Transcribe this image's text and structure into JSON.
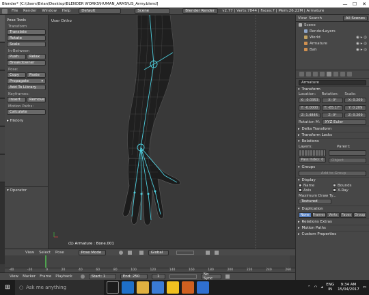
{
  "titlebar": {
    "title": "Blender* [C:\\Users\\Brian\\Desktop\\BLENDER WORKS\\HUMAN_ARMS\\US_Army.blend]",
    "controls": [
      "—",
      "☐",
      "✕"
    ]
  },
  "infobar": {
    "menus": [
      "File",
      "Render",
      "Window",
      "Help"
    ],
    "layout": "Default",
    "scene": "Scene",
    "engine": "Blender Render",
    "stats": "v2.77 | Verts:7844 | Faces:7 | Mem:26.22M | Armature"
  },
  "shelf": {
    "title": "Pose Tools",
    "transform_header": "Transform",
    "transform_buttons": [
      "Translate",
      "Rotate",
      "Scale"
    ],
    "inbetween_header": "In-Between",
    "inbetween_row": [
      "Push",
      "Relax"
    ],
    "breakdowner": "Breakdowner",
    "pose_header": "Pose:",
    "pose_row": [
      "Copy",
      "Paste"
    ],
    "propagate": "Propagate",
    "add_library": "Add To Library",
    "keyframes_header": "Keyframes:",
    "keyframes_row": [
      "Insert",
      "Remove"
    ],
    "motion_header": "Motion Paths:",
    "calculate": "Calculate",
    "history": "History",
    "operator": "Operator"
  },
  "viewport": {
    "title": "User Ortho",
    "status": "(1) Armature : Bone.001"
  },
  "vpheader": {
    "menus": [
      "View",
      "Select",
      "Pose"
    ],
    "mode": "Pose Mode",
    "orientation": "Global"
  },
  "timeline": {
    "ruler": [
      "-40",
      "-20",
      "0",
      "20",
      "40",
      "60",
      "80",
      "100",
      "120",
      "140",
      "160",
      "180",
      "200",
      "220",
      "240",
      "260"
    ],
    "menus": [
      "View",
      "Marker",
      "Frame",
      "Playback"
    ],
    "start_label": "Start:",
    "start": "1",
    "end_label": "End:",
    "end": "250",
    "current": "1",
    "sync": "No Sync"
  },
  "outliner": {
    "menus": [
      "View",
      "Search",
      "All Scenes"
    ],
    "items": [
      {
        "label": "Scene",
        "color": "#b0b0b0"
      },
      {
        "label": "RenderLayers",
        "color": "#8ea5c8"
      },
      {
        "label": "World",
        "color": "#c0a060"
      },
      {
        "label": "Armature",
        "color": "#d09050"
      },
      {
        "label": "Bah",
        "color": "#d09050"
      }
    ]
  },
  "props": {
    "object_name": "Armature",
    "transform": "Transform",
    "location_label": "Location:",
    "rotation_label": "Rotation:",
    "scale_label": "Scale:",
    "location": [
      "X: -0.0353",
      "Y: -0.0000",
      "Z: 1.4846"
    ],
    "rotation": [
      "X: 0°",
      "Y: -85.17°",
      "Z: 0°"
    ],
    "scale": [
      "X: 0.209",
      "Y: 0.209",
      "Z: 0.209"
    ],
    "rotation_mode_label": "Rotation M:",
    "rotation_mode": "XYZ Euler",
    "sections1": [
      "Delta Transform",
      "Transform Locks"
    ],
    "relations": "Relations",
    "layers_label": "Layers:",
    "parent_label": "Parent:",
    "parent_value": "Object",
    "pass_index": "Pass Index:",
    "pass_index_value": "0",
    "groups": "Groups",
    "add_to_group": "Add to Group",
    "display": "Display",
    "display_opts": [
      "Name",
      "Axis",
      "Bounds",
      "X-Ray"
    ],
    "max_draw_label": "Maximum Draw Ty...",
    "max_draw": "Textured",
    "duplication": "Duplication",
    "dup_tabs": [
      "None",
      "Frames",
      "Verts",
      "Faces",
      "Group"
    ],
    "sections2": [
      "Relations Extras",
      "Motion Paths",
      "Custom Properties"
    ]
  },
  "taskbar": {
    "search": "Ask me anything",
    "lang1": "ENG",
    "lang2": "IN",
    "time": "9:34 AM",
    "date": "15/04/2017"
  }
}
